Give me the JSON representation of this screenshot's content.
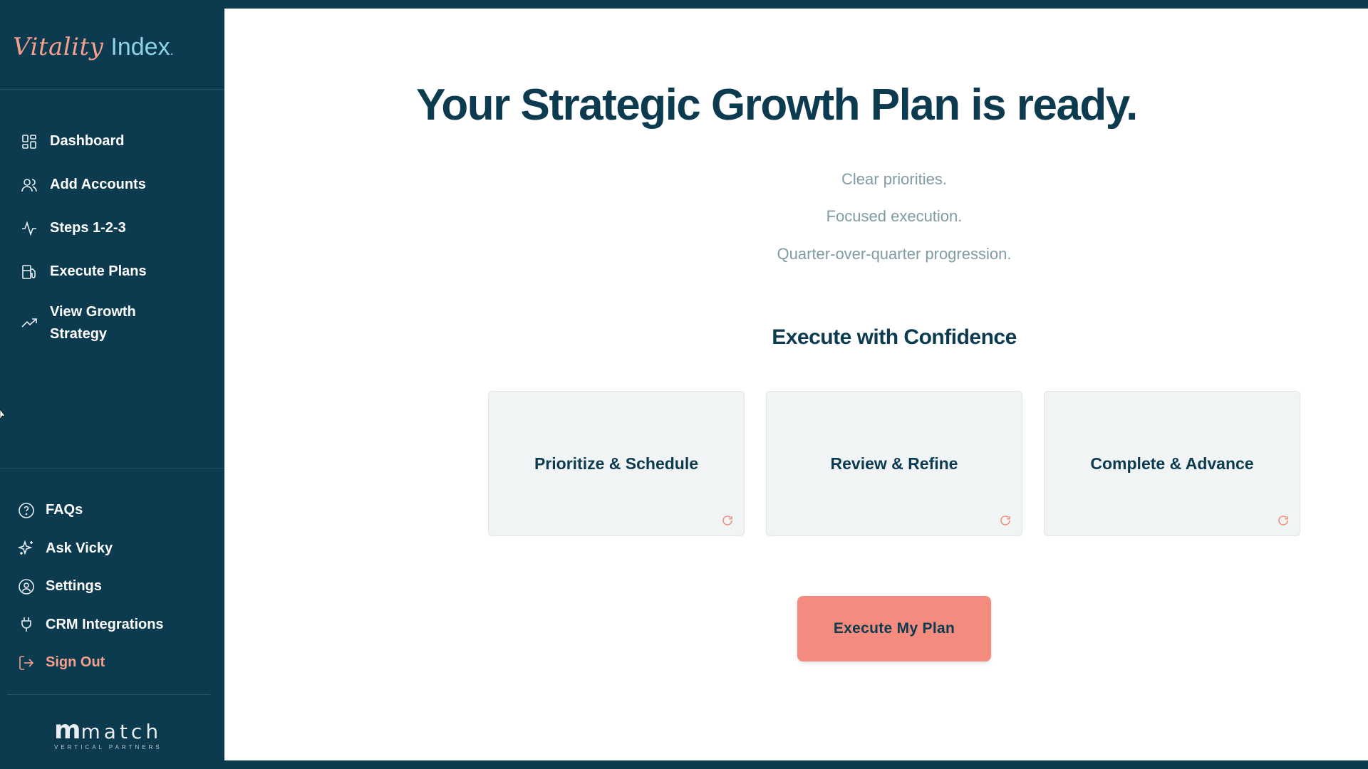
{
  "app": {
    "logo_word1": "Vitality",
    "logo_word2": "Index",
    "logo_dot": ".",
    "accent_color": "#f38c7e",
    "brand_color": "#0c3b4f"
  },
  "sidebar": {
    "items": [
      {
        "label": "Dashboard",
        "icon": "dashboard-grid-icon"
      },
      {
        "label": "Add Accounts",
        "icon": "users-icon"
      },
      {
        "label": "Steps 1-2-3",
        "icon": "activity-icon"
      },
      {
        "label": "Execute Plans",
        "icon": "fuel-pump-icon"
      },
      {
        "label": "View Growth Strategy",
        "icon": "trending-up-icon"
      }
    ],
    "bottom_items": [
      {
        "label": "FAQs",
        "icon": "help-circle-icon"
      },
      {
        "label": "Ask Vicky",
        "icon": "sparkles-icon"
      },
      {
        "label": "Settings",
        "icon": "user-circle-icon"
      },
      {
        "label": "CRM Integrations",
        "icon": "plug-icon"
      },
      {
        "label": "Sign Out",
        "icon": "log-out-icon"
      }
    ],
    "brand_mark": {
      "m": "m",
      "match": "match",
      "sub": "VERTICAL PARTNERS"
    }
  },
  "main": {
    "headline": "Your Strategic Growth Plan is ready.",
    "taglines": [
      "Clear priorities.",
      "Focused execution.",
      "Quarter-over-quarter progression."
    ],
    "section_title": "Execute with Confidence",
    "cards": [
      {
        "label": "Prioritize & Schedule"
      },
      {
        "label": "Review & Refine"
      },
      {
        "label": "Complete & Advance"
      }
    ],
    "cta_label": "Execute My Plan"
  }
}
